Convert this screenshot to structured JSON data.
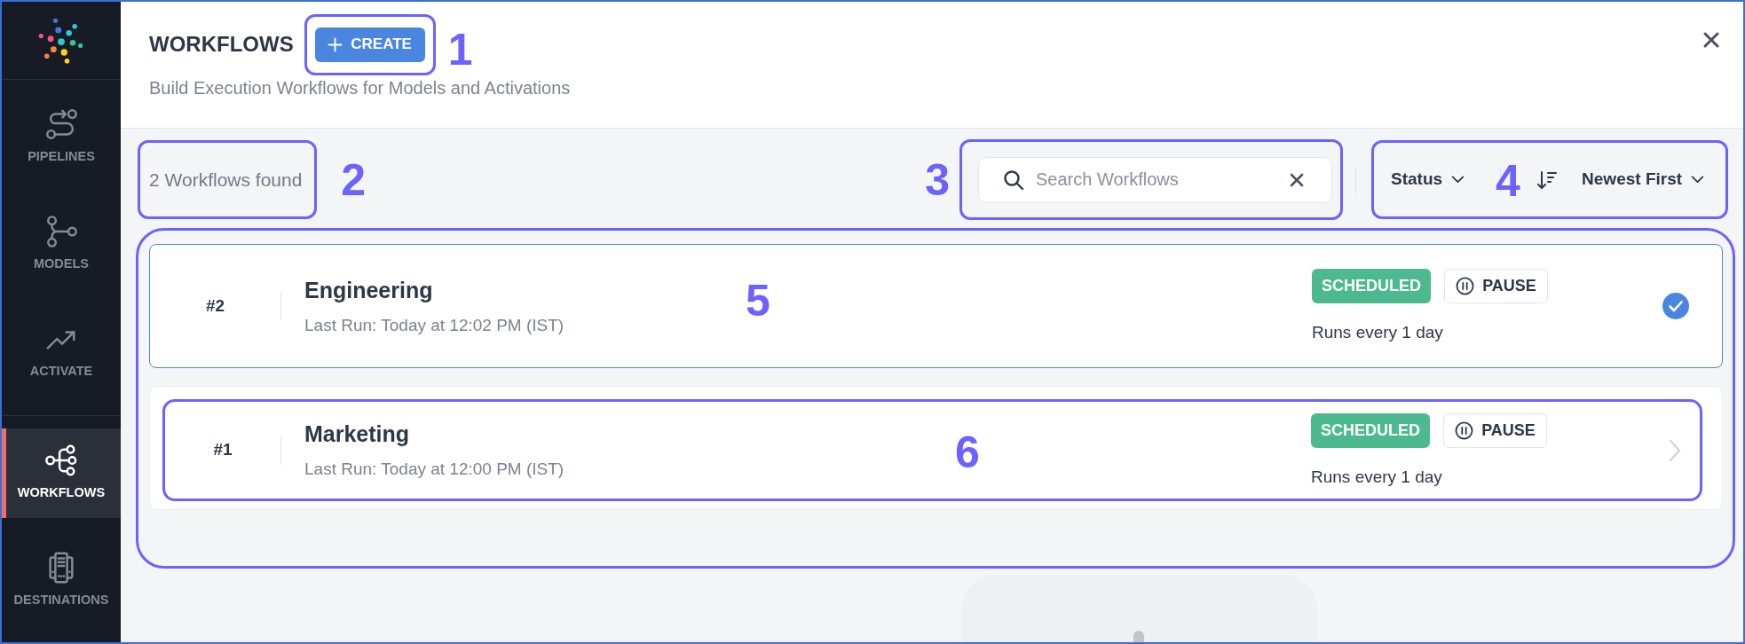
{
  "sidebar": {
    "sections": [
      {
        "items": [
          {
            "label": "PIPELINES",
            "selected": false
          },
          {
            "label": "MODELS",
            "selected": false
          },
          {
            "label": "ACTIVATE",
            "selected": false
          }
        ]
      },
      {
        "items": [
          {
            "label": "WORKFLOWS",
            "selected": true
          },
          {
            "label": "DESTINATIONS",
            "selected": false
          }
        ]
      }
    ]
  },
  "header": {
    "title": "WORKFLOWS",
    "create_button": {
      "label": "CREATE",
      "callout": "1"
    },
    "subtitle": "Build Execution Workflows for Models and Activations"
  },
  "toolbar": {
    "result_count": {
      "text": "2 Workflows found",
      "callout": "2"
    },
    "search": {
      "placeholder": "Search Workflows",
      "callout": "3"
    },
    "sorting": {
      "status_filter": "Status",
      "sort_order": "Newest First",
      "callout": "4"
    }
  },
  "workflows": {
    "callout": "5",
    "rows": [
      {
        "number": "#2",
        "name": "Engineering",
        "last_run": "Last Run: Today at 12:02 PM (IST)",
        "status": "SCHEDULED",
        "action": "PAUSE",
        "schedule": "Runs every 1 day",
        "selected": true
      },
      {
        "number": "#1",
        "name": "Marketing",
        "last_run": "Last Run: Today at 12:00 PM (IST)",
        "status": "SCHEDULED",
        "action": "PAUSE",
        "schedule": "Runs every 1 day",
        "selected": false,
        "callout": "6"
      }
    ]
  }
}
